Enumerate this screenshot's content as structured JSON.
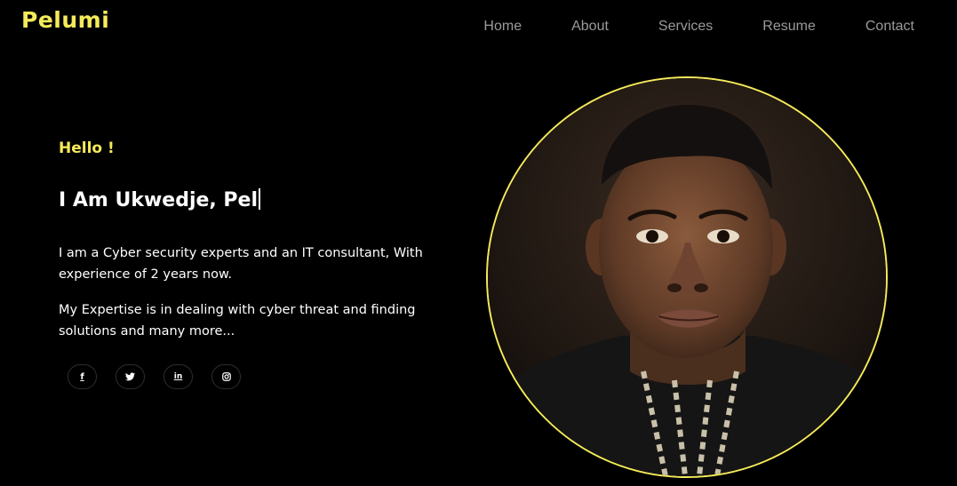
{
  "brand": {
    "logo": "Pelumi",
    "accent": "#f5ea5a"
  },
  "nav": {
    "items": [
      {
        "label": "Home"
      },
      {
        "label": "About"
      },
      {
        "label": "Services"
      },
      {
        "label": "Resume"
      },
      {
        "label": "Contact"
      }
    ]
  },
  "hero": {
    "greeting": "Hello !",
    "headline": "I Am Ukwedje, Pel",
    "paragraph_1": "I am a Cyber security experts and an IT consultant, With experience of 2 years now.",
    "paragraph_2": "My Expertise is in dealing with cyber threat and finding solutions and many more...",
    "portrait_icon": "profile-photo"
  },
  "social": [
    {
      "icon": "facebook-icon",
      "glyph": "f"
    },
    {
      "icon": "twitter-icon",
      "glyph": ""
    },
    {
      "icon": "linkedin-icon",
      "glyph": "in"
    },
    {
      "icon": "instagram-icon",
      "glyph": ""
    }
  ]
}
